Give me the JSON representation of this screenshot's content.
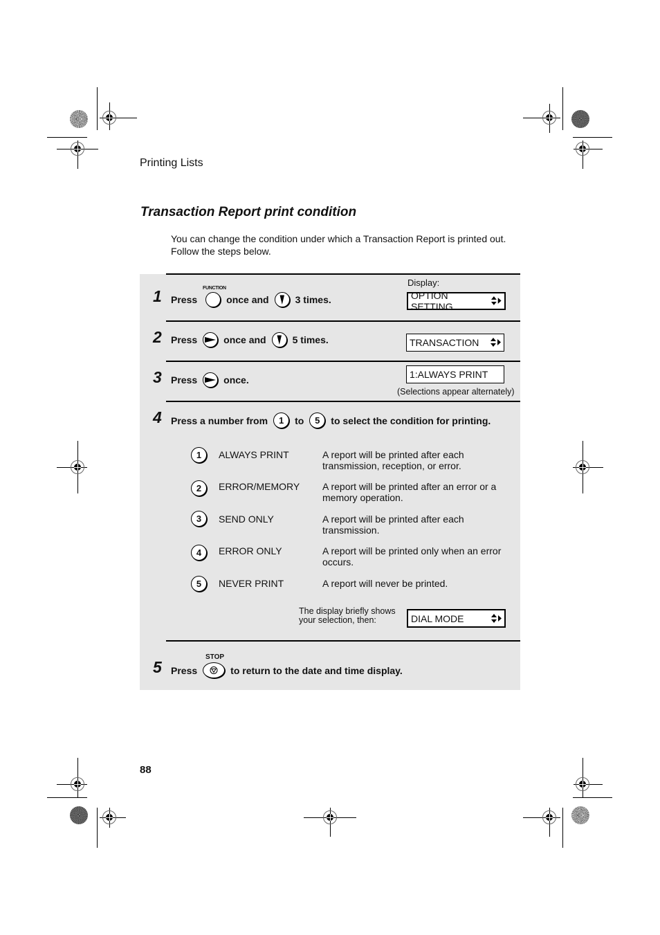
{
  "header": {
    "section": "Printing Lists"
  },
  "title": "Transaction Report print condition",
  "intro": [
    "You can change the condition under which a Transaction Report is printed out.",
    "Follow the steps below."
  ],
  "display_label": "Display:",
  "steps": [
    {
      "number": "1",
      "press": "Press",
      "key1_label": "FUNCTION",
      "mid": "once and",
      "suffix": "3 times.",
      "display": "OPTION SETTING"
    },
    {
      "number": "2",
      "press": "Press",
      "mid": "once and",
      "suffix": "5 times.",
      "display": "TRANSACTION"
    },
    {
      "number": "3",
      "press": "Press",
      "suffix": "once.",
      "display": "1:ALWAYS PRINT",
      "note": "(Selections appear alternately)"
    },
    {
      "number": "4",
      "prefix": "Press a number from",
      "key_from": "1",
      "mid": "to",
      "key_to": "5",
      "suffix": "to select the condition for printing.",
      "options": [
        {
          "key": "1",
          "name": "ALWAYS PRINT",
          "desc": [
            "A report will be printed after each",
            "transmission, reception, or error."
          ]
        },
        {
          "key": "2",
          "name": "ERROR/MEMORY",
          "desc": [
            "A report will be printed after an error or a",
            "memory operation."
          ]
        },
        {
          "key": "3",
          "name": "SEND ONLY",
          "desc": [
            "A report will be printed after each",
            "transmission."
          ]
        },
        {
          "key": "4",
          "name": "ERROR ONLY",
          "desc": [
            "A report will be printed only when an error",
            "occurs."
          ]
        },
        {
          "key": "5",
          "name": "NEVER PRINT",
          "desc": [
            "A report will never be printed.",
            ""
          ]
        }
      ],
      "after_note": [
        "The display briefly shows",
        "your selection, then:"
      ],
      "display": "DIAL MODE"
    },
    {
      "number": "5",
      "press": "Press",
      "key_label": "STOP",
      "suffix": "to return to the date and time display."
    }
  ],
  "page_number": "88",
  "colors": {
    "panel": "#e6e6e6",
    "rule": "#000000"
  }
}
